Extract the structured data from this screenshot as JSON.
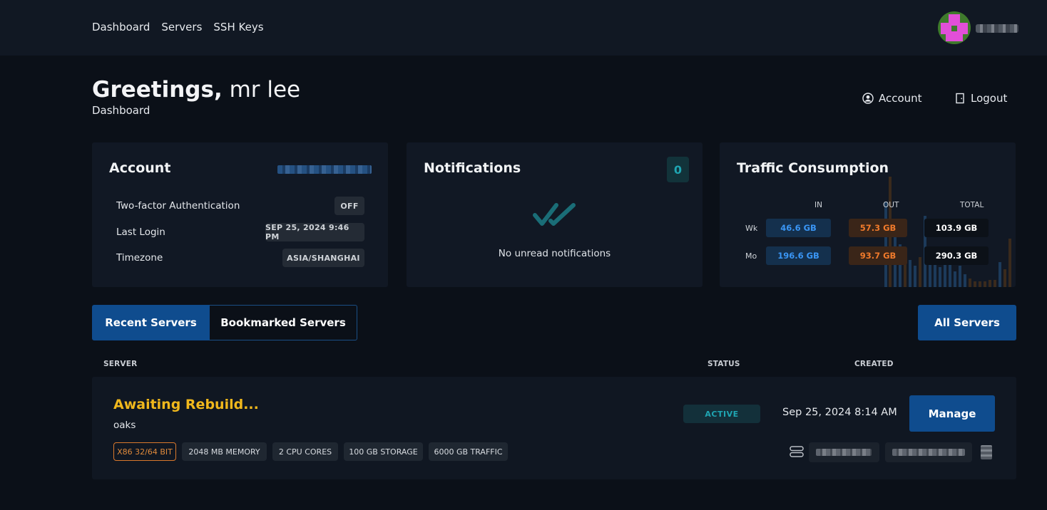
{
  "nav": {
    "items": [
      "Dashboard",
      "Servers",
      "SSH Keys"
    ]
  },
  "header": {
    "greeting_bold": "Greetings,",
    "greeting_name": "mr lee",
    "subtitle": "Dashboard",
    "account_label": "Account",
    "logout_label": "Logout"
  },
  "account_card": {
    "title": "Account",
    "rows": [
      {
        "label": "Two-factor Authentication",
        "value": "OFF"
      },
      {
        "label": "Last Login",
        "value": "SEP 25, 2024 9:46 PM"
      },
      {
        "label": "Timezone",
        "value": "ASIA/SHANGHAI"
      }
    ]
  },
  "notifications_card": {
    "title": "Notifications",
    "count": "0",
    "empty_text": "No unread notifications"
  },
  "traffic_card": {
    "title": "Traffic Consumption",
    "headers": {
      "in": "IN",
      "out": "OUT",
      "total": "TOTAL"
    },
    "rows": [
      {
        "label": "Wk",
        "in": "46.6 GB",
        "out": "57.3 GB",
        "total": "103.9 GB"
      },
      {
        "label": "Mo",
        "in": "196.6 GB",
        "out": "93.7 GB",
        "total": "290.3 GB"
      }
    ]
  },
  "tabs": {
    "recent": "Recent Servers",
    "bookmarked": "Bookmarked Servers",
    "all_servers": "All Servers"
  },
  "table": {
    "col_server": "SERVER",
    "col_status": "STATUS",
    "col_created": "CREATED"
  },
  "server": {
    "title": "Awaiting Rebuild...",
    "name": "oaks",
    "specs": [
      "X86 32/64 BIT",
      "2048 MB MEMORY",
      "2 CPU CORES",
      "100 GB STORAGE",
      "6000 GB TRAFFIC"
    ],
    "status": "ACTIVE",
    "created": "Sep 25, 2024 8:14 AM",
    "manage_label": "Manage"
  },
  "colors": {
    "primary": "#0f4c8e",
    "accent_yellow": "#f0b81c",
    "in_blue": "#3a96f5",
    "out_orange": "#f07a2b",
    "status_teal": "#1fa5b2"
  },
  "icons": {
    "account": "user-circle-icon",
    "logout": "door-exit-icon",
    "notif_empty": "double-check-icon",
    "server": "server-stack-icon"
  }
}
